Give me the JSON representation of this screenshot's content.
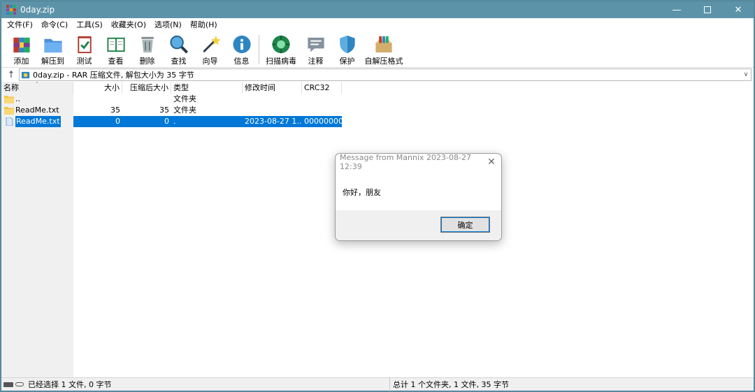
{
  "window": {
    "title": "0day.zip",
    "minimize_icon": "minimize-icon",
    "maximize_icon": "maximize-icon",
    "close_icon": "close-icon"
  },
  "menu": [
    "文件(F)",
    "命令(C)",
    "工具(S)",
    "收藏夹(O)",
    "选项(N)",
    "帮助(H)"
  ],
  "toolbar": [
    {
      "label": "添加",
      "icon": "add-archive-icon"
    },
    {
      "label": "解压到",
      "icon": "extract-folder-icon"
    },
    {
      "label": "测试",
      "icon": "test-clipboard-icon"
    },
    {
      "label": "查看",
      "icon": "view-book-icon"
    },
    {
      "label": "删除",
      "icon": "trash-icon"
    },
    {
      "label": "查找",
      "icon": "magnifier-icon"
    },
    {
      "label": "向导",
      "icon": "wizard-wand-icon"
    },
    {
      "label": "信息",
      "icon": "info-icon"
    },
    {
      "label": "扫描病毒",
      "icon": "virus-scan-icon"
    },
    {
      "label": "注释",
      "icon": "comment-icon"
    },
    {
      "label": "保护",
      "icon": "shield-icon"
    },
    {
      "label": "自解压格式",
      "icon": "sfx-box-icon"
    }
  ],
  "address": {
    "text": "0day.zip - RAR 压缩文件, 解包大小为 35 字节"
  },
  "columns": {
    "name": "名称",
    "size": "大小",
    "packed": "压缩后大小",
    "type": "类型",
    "modified": "修改时间",
    "crc": "CRC32"
  },
  "rows": [
    {
      "name": "..",
      "size": "",
      "packed": "",
      "type": "文件夹",
      "modified": "",
      "crc": "",
      "icon": "folder-icon",
      "selected": false
    },
    {
      "name": "ReadMe.txt",
      "size": "35",
      "packed": "35",
      "type": "文件夹",
      "modified": "",
      "crc": "",
      "icon": "folder-icon",
      "selected": false
    },
    {
      "name": "ReadMe.txt",
      "size": "0",
      "packed": "0",
      "type": ".",
      "modified": "2023-08-27 1...",
      "crc": "00000000",
      "icon": "file-icon",
      "selected": true
    }
  ],
  "status": {
    "left": "已经选择 1 文件, 0 字节",
    "right": "总计 1 个文件夹, 1 文件, 35 字节"
  },
  "dialog": {
    "title": "Message from Mannix 2023-08-27 12:39",
    "message": "你好，朋友",
    "ok_label": "确定"
  },
  "colors": {
    "titlebar": "#5d93a8",
    "selection": "#0078d7"
  }
}
